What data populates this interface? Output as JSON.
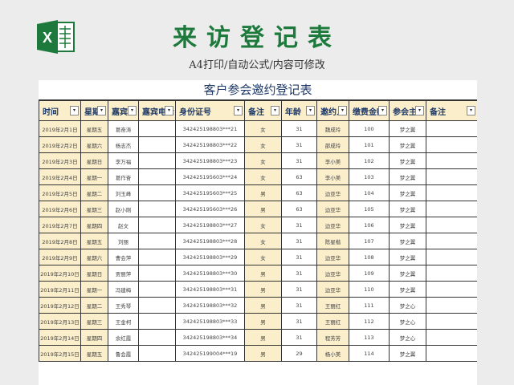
{
  "header": {
    "title": "来访登记表",
    "subtitle": "A4打印/自动公式/内容可修改",
    "logo_icon": "excel-logo-icon",
    "brand_color": "#1e7a3c"
  },
  "sheet": {
    "title": "客户参会邀约登记表",
    "filter_icon": "▾",
    "columns": [
      "时间",
      "星期",
      "嘉宾姓",
      "嘉宾电话",
      "身份证号",
      "备注",
      "年龄",
      "邀约人",
      "缴费金额",
      "参会主",
      "备注"
    ],
    "rows": [
      [
        "2019年2月1日",
        "星期五",
        "葛奋涛",
        "",
        "342425198803***21",
        "女",
        "31",
        "魏成玲",
        "100",
        "梦之翼",
        ""
      ],
      [
        "2019年2月2日",
        "星期六",
        "杨志杰",
        "",
        "342425198803***22",
        "女",
        "31",
        "邵成玲",
        "101",
        "梦之翼",
        ""
      ],
      [
        "2019年2月3日",
        "星期日",
        "李万福",
        "",
        "342425198803***23",
        "女",
        "31",
        "李小美",
        "102",
        "梦之翼",
        ""
      ],
      [
        "2019年2月4日",
        "星期一",
        "葛作奋",
        "",
        "342425195603***24",
        "女",
        "63",
        "李小美",
        "103",
        "梦之翼",
        ""
      ],
      [
        "2019年2月5日",
        "星期二",
        "刘玉峰",
        "",
        "342425195603***25",
        "男",
        "63",
        "边亚华",
        "104",
        "梦之翼",
        ""
      ],
      [
        "2019年2月6日",
        "星期三",
        "赵小刚",
        "",
        "342425195603***26",
        "男",
        "63",
        "边亚华",
        "105",
        "梦之翼",
        ""
      ],
      [
        "2019年2月7日",
        "星期四",
        "赵文",
        "",
        "342425198803***27",
        "女",
        "31",
        "边亚华",
        "106",
        "梦之翼",
        ""
      ],
      [
        "2019年2月8日",
        "星期五",
        "刘丽",
        "",
        "342425198803***28",
        "女",
        "31",
        "陈星楷",
        "107",
        "梦之翼",
        ""
      ],
      [
        "2019年2月9日",
        "星期六",
        "曹会萍",
        "",
        "342425198803***29",
        "女",
        "31",
        "边亚华",
        "108",
        "梦之翼",
        ""
      ],
      [
        "2019年2月10日",
        "星期日",
        "贾丽萍",
        "",
        "342425198803***30",
        "男",
        "31",
        "边亚华",
        "109",
        "梦之翼",
        ""
      ],
      [
        "2019年2月11日",
        "星期一",
        "冯建梅",
        "",
        "342425198803***31",
        "男",
        "31",
        "边亚华",
        "110",
        "梦之翼",
        ""
      ],
      [
        "2019年2月12日",
        "星期二",
        "王秀琴",
        "",
        "342425198803***32",
        "男",
        "31",
        "王丽红",
        "111",
        "梦之心",
        ""
      ],
      [
        "2019年2月13日",
        "星期三",
        "王金柯",
        "",
        "342425198803***33",
        "男",
        "31",
        "王丽红",
        "112",
        "梦之心",
        ""
      ],
      [
        "2019年2月14日",
        "星期四",
        "余红霞",
        "",
        "342425198803***34",
        "男",
        "31",
        "程芳芳",
        "113",
        "梦之心",
        ""
      ],
      [
        "2019年2月15日",
        "星期五",
        "鲁会霞",
        "",
        "342425199004***19",
        "男",
        "29",
        "杨小美",
        "114",
        "梦之翼",
        ""
      ]
    ]
  }
}
